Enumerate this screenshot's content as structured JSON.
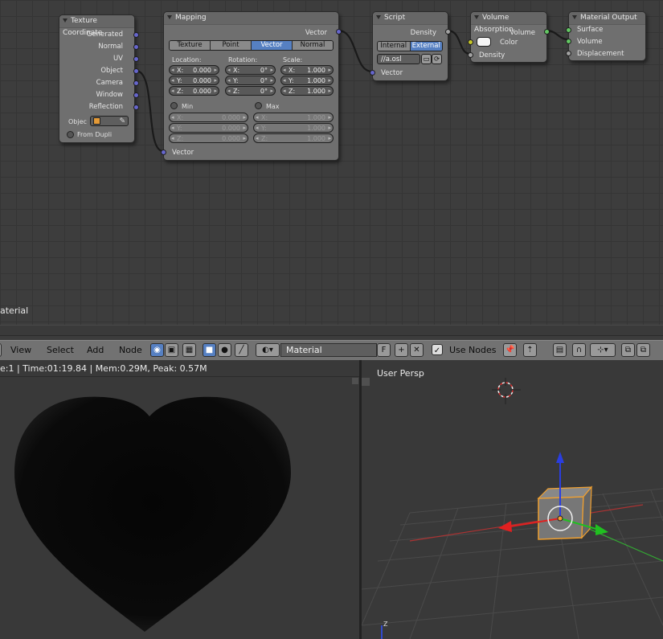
{
  "nodes": {
    "texture_coordinate": {
      "title": "Texture Coordinate",
      "outputs": [
        "Generated",
        "Normal",
        "UV",
        "Object",
        "Camera",
        "Window",
        "Reflection"
      ],
      "object_label": "Objec",
      "from_dupli": "From Dupli"
    },
    "mapping": {
      "title": "Mapping",
      "output": "Vector",
      "tabs": [
        "Texture",
        "Point",
        "Vector",
        "Normal"
      ],
      "active_tab": "Vector",
      "location_label": "Location:",
      "rotation_label": "Rotation:",
      "scale_label": "Scale:",
      "location": [
        {
          "axis": "X:",
          "value": "0.000"
        },
        {
          "axis": "Y:",
          "value": "0.000"
        },
        {
          "axis": "Z:",
          "value": "0.000"
        }
      ],
      "rotation": [
        {
          "axis": "X:",
          "value": "0°"
        },
        {
          "axis": "Y:",
          "value": "0°"
        },
        {
          "axis": "Z:",
          "value": "0°"
        }
      ],
      "scale": [
        {
          "axis": "X:",
          "value": "1.000"
        },
        {
          "axis": "Y:",
          "value": "1.000"
        },
        {
          "axis": "Z:",
          "value": "1.000"
        }
      ],
      "min_label": "Min",
      "max_label": "Max",
      "min": [
        {
          "axis": "X:",
          "value": "0.000"
        },
        {
          "axis": "Y:",
          "value": "0.000"
        },
        {
          "axis": "Z:",
          "value": "0.000"
        }
      ],
      "max": [
        {
          "axis": "X:",
          "value": "1.000"
        },
        {
          "axis": "Y:",
          "value": "1.000"
        },
        {
          "axis": "Z:",
          "value": "1.000"
        }
      ],
      "input": "Vector"
    },
    "script": {
      "title": "Script",
      "output": "Density",
      "mode_internal": "Internal",
      "mode_external": "External",
      "filepath": "//a.osl",
      "input": "Vector"
    },
    "volume_absorption": {
      "title": "Volume Absorption",
      "output": "Volume",
      "color_label": "Color",
      "density_label": "Density"
    },
    "material_output": {
      "title": "Material Output",
      "inputs": [
        "Surface",
        "Volume",
        "Displacement"
      ]
    }
  },
  "frame_label": "aterial",
  "header": {
    "menus": [
      "View",
      "Select",
      "Add",
      "Node"
    ],
    "material_name": "Material",
    "fake_user": "F",
    "use_nodes_label": "Use Nodes",
    "use_nodes_checked": true
  },
  "render": {
    "info": "e:1 | Time:01:19.84 | Mem:0.29M, Peak: 0.57M"
  },
  "viewport": {
    "label": "User Persp",
    "axis_z": "Z"
  },
  "colors": {
    "accent": "#5680c2",
    "vector_socket": "#6666cc",
    "float_socket": "#a1a1a1",
    "color_socket": "#c7c729",
    "shader_socket": "#63c763",
    "selection": "#f0a030"
  }
}
